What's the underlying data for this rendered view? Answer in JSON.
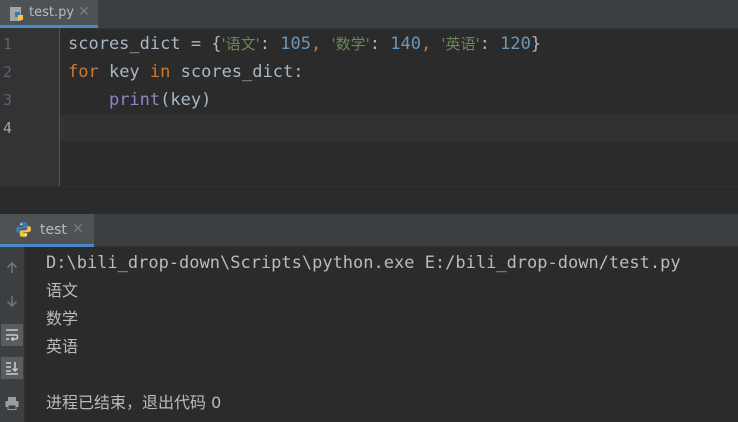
{
  "editor": {
    "tab": {
      "filename": "test.py",
      "icon": "python-file-icon",
      "close_glyph": "✕"
    },
    "line_numbers": [
      "1",
      "2",
      "3",
      "4"
    ],
    "code": {
      "line1": {
        "var": "scores_dict",
        "eq": " = {",
        "s1": "'语文'",
        "c1": ": ",
        "n1": "105",
        "p1": ", ",
        "s2": "'数学'",
        "c2": ": ",
        "n2": "140",
        "p2": ", ",
        "s3": "'英语'",
        "c3": ": ",
        "n3": "120",
        "end": "}"
      },
      "line2": {
        "kw1": "for",
        "t1": " key ",
        "kw2": "in",
        "t2": " scores_dict:"
      },
      "line3": {
        "indent": "    ",
        "fn": "print",
        "args": "(key)"
      }
    }
  },
  "run": {
    "tab": {
      "label": "test",
      "icon": "python-run-icon",
      "close_glyph": "✕"
    },
    "tools": [
      "up-arrow-icon",
      "down-arrow-icon",
      "soft-wrap-icon",
      "scroll-to-end-icon",
      "print-icon"
    ],
    "console": {
      "command": "D:\\bili_drop-down\\Scripts\\python.exe E:/bili_drop-down/test.py",
      "outputs": [
        "语文",
        "数学",
        "英语"
      ],
      "exit_message": "进程已结束，退出代码 0"
    }
  },
  "colors": {
    "background": "#2b2b2b",
    "keyword": "#cc7832",
    "string": "#6a8759",
    "number": "#6897bb",
    "builtin": "#8888c6",
    "accent": "#4a88c7"
  }
}
